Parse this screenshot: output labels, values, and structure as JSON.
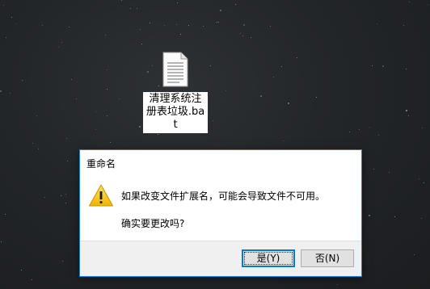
{
  "desktop": {
    "file": {
      "name": "清理系统注册表垃圾.bat",
      "icon": "batch-file-icon"
    }
  },
  "dialog": {
    "title": "重命名",
    "icon": "warning-icon",
    "message": "如果改变文件扩展名，可能会导致文件不可用。",
    "question": "确实要更改吗?",
    "buttons": {
      "yes_label": "是(Y)",
      "no_label": "否(N)"
    }
  },
  "colors": {
    "accent": "#0078d7",
    "warning_yellow": "#f5c21b",
    "dialog_footer": "#f0f0f0"
  }
}
